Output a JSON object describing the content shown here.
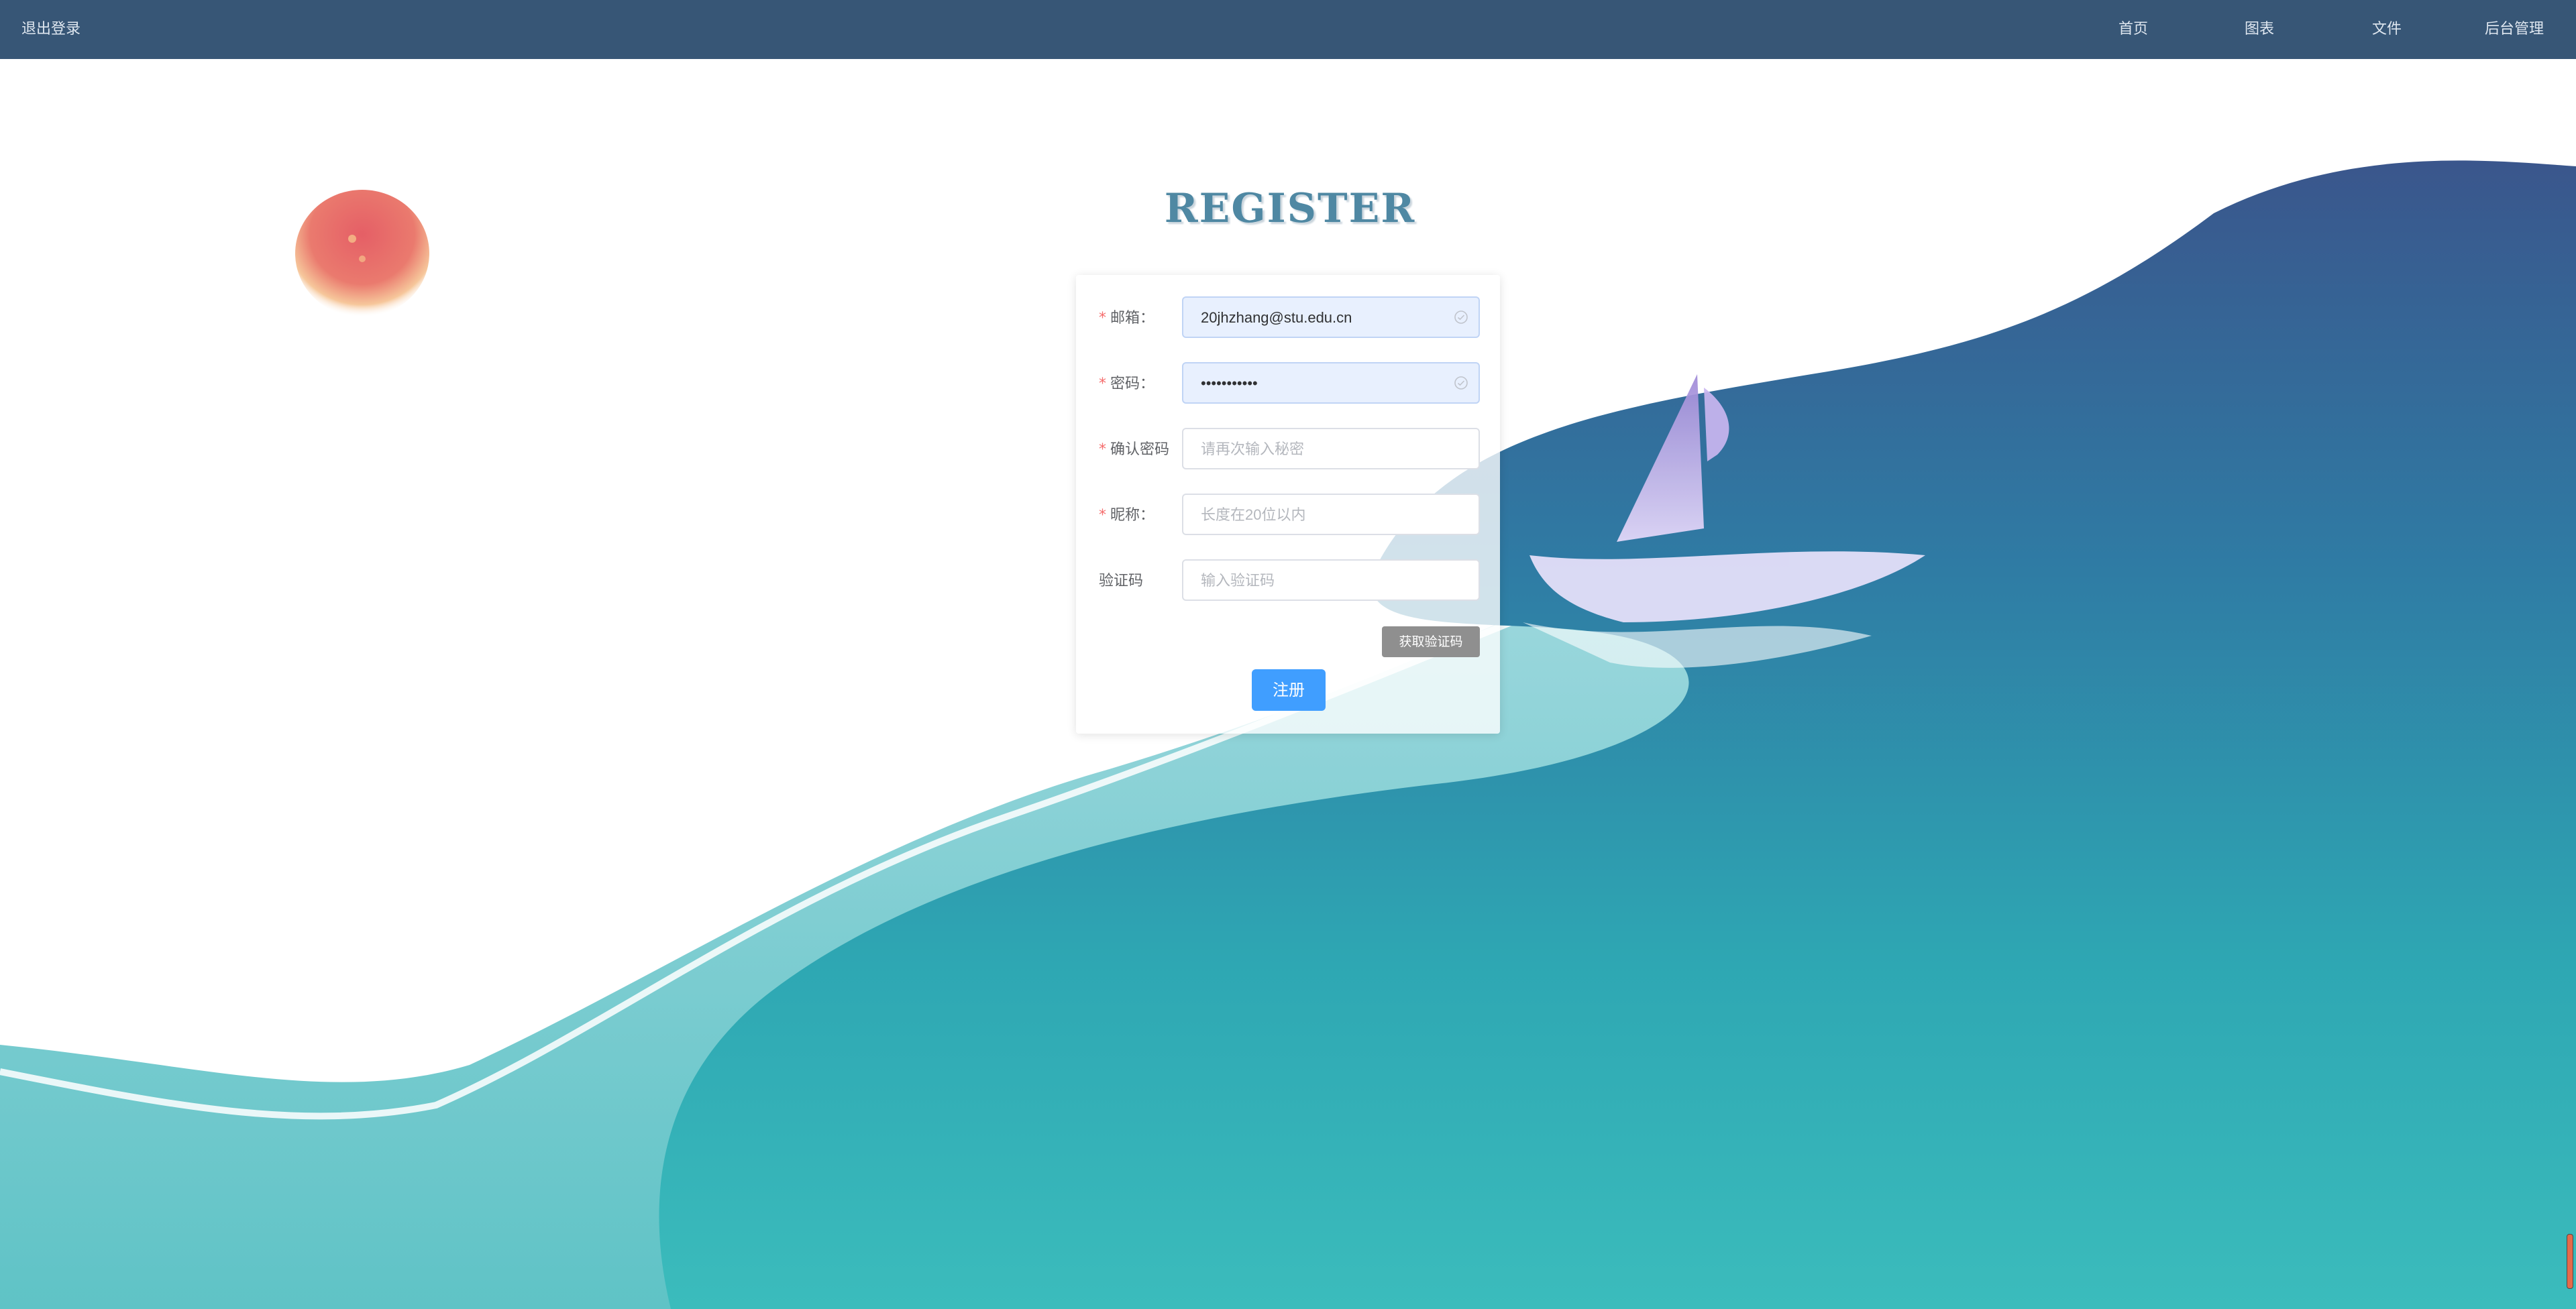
{
  "nav": {
    "logout": "退出登录",
    "links": [
      "首页",
      "图表",
      "文件",
      "后台管理"
    ]
  },
  "title": "REGISTER",
  "form": {
    "email": {
      "label": "邮箱：",
      "value": "20jhzhang@stu.edu.cn",
      "required": true
    },
    "password": {
      "label": "密码：",
      "value": "•••••••••••",
      "required": true
    },
    "confirm": {
      "label": "确认密码",
      "placeholder": "请再次输入秘密",
      "required": true
    },
    "nickname": {
      "label": "昵称：",
      "placeholder": "长度在20位以内",
      "required": true
    },
    "code": {
      "label": "验证码",
      "placeholder": "输入验证码",
      "required": false
    },
    "get_code_label": "获取验证码",
    "submit_label": "注册",
    "required_mark": "*"
  },
  "colors": {
    "navbar": "#375676",
    "primary": "#409eff",
    "sea_top": "#3c5a8d",
    "sea_bottom": "#3ab8b8",
    "sun": "#e86a6a"
  },
  "icons": {
    "field_valid": "circle-check-icon"
  }
}
